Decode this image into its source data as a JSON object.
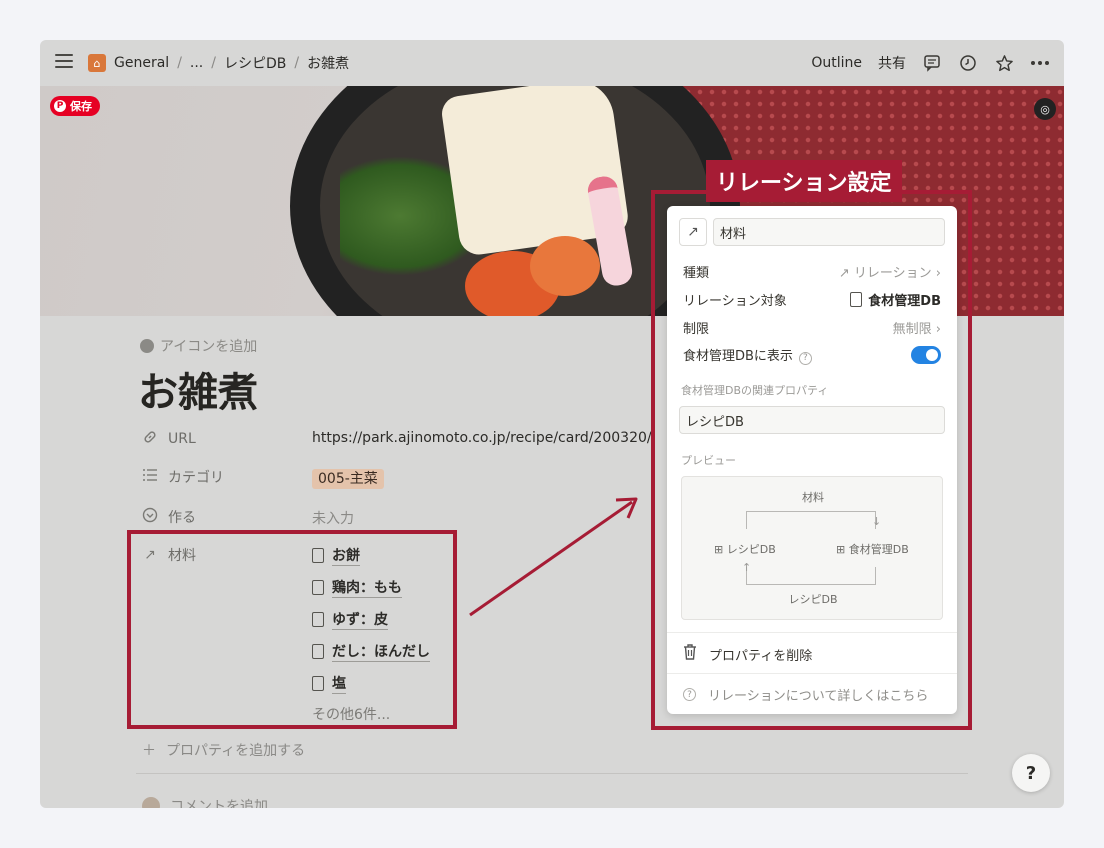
{
  "breadcrumb": [
    "General",
    "...",
    "レシピDB",
    "お雑煮"
  ],
  "toolbar": {
    "outline": "Outline",
    "share": "共有"
  },
  "cover": {
    "pin_save": "保存"
  },
  "page": {
    "add_icon": "アイコンを追加",
    "title": "お雑煮",
    "properties": [
      {
        "label": "URL",
        "value": "https://park.ajinomoto.co.jp/recipe/card/200320/"
      },
      {
        "label": "カテゴリ",
        "value": "005-主菜"
      },
      {
        "label": "作る",
        "value": "未入力"
      },
      {
        "label": "材料",
        "items": [
          "お餅",
          "鶏肉：もも",
          "ゆず：皮",
          "だし：ほんだし",
          "塩"
        ],
        "more": "その他6件..."
      }
    ],
    "add_property": "プロパティを追加する",
    "add_comment": "コメントを追加"
  },
  "panel": {
    "label": "リレーション設定",
    "name": "材料",
    "rows": [
      {
        "label": "種類",
        "value": "リレーション"
      },
      {
        "label": "リレーション対象",
        "value": "食材管理DB"
      },
      {
        "label": "制限",
        "value": "無制限"
      },
      {
        "label": "食材管理DBに表示"
      }
    ],
    "related_label": "食材管理DBの関連プロパティ",
    "related_value": "レシピDB",
    "preview_label": "プレビュー",
    "preview": {
      "top": "材料",
      "left": "レシピDB",
      "right": "食材管理DB",
      "bottom": "レシピDB"
    },
    "delete": "プロパティを削除",
    "learn_more": "リレーションについて詳しくはこちら"
  },
  "help": "?"
}
